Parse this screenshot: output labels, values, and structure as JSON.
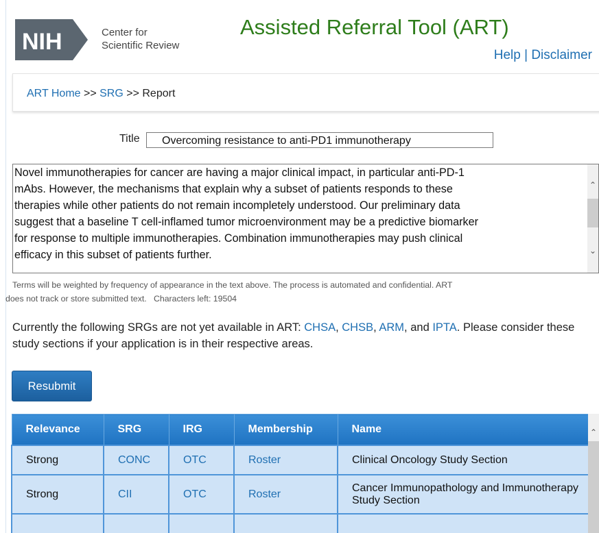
{
  "header": {
    "logo_text": "NIH",
    "org_line1": "Center for",
    "org_line2": "Scientific Review",
    "app_title": "Assisted Referral Tool (ART)",
    "help_link": "Help",
    "separator": "|",
    "disclaimer_link": "Disclaimer"
  },
  "breadcrumb": {
    "home": "ART Home",
    "sep1": " >> ",
    "srg": "SRG",
    "sep2": " >> ",
    "current": "Report"
  },
  "form": {
    "title_label": "Title",
    "title_value": "Overcoming resistance to anti-PD1 immunotherapy",
    "abstract_lines": [
      "Novel immunotherapies for cancer are having a major clinical impact, in particular anti-PD-1",
      "mAbs. However, the mechanisms that explain why a subset of patients responds to these",
      "therapies while other patients do not remain incompletely understood. Our preliminary data",
      "suggest that a baseline T cell-inflamed tumor microenvironment may be a predictive biomarker",
      "for response to multiple immunotherapies. Combination immunotherapies may push clinical",
      "efficacy in this subset of patients further."
    ],
    "hint_line1": "Terms will be weighted by frequency of appearance in the text above. The process is automated and confidential. ART",
    "hint_line2": "does not track or store submitted text.",
    "chars_left_label": "Characters left:",
    "chars_left_value": "19504",
    "resubmit_label": "Resubmit"
  },
  "notice": {
    "prefix": "Currently the following SRGs are not yet available in ART: ",
    "links": [
      "CHSA",
      "CHSB",
      "ARM",
      "IPTA"
    ],
    "comma": ", ",
    "and": ", and ",
    "suffix": ". Please consider these study sections if your application is in their respective areas."
  },
  "table": {
    "columns": [
      "Relevance",
      "SRG",
      "IRG",
      "Membership",
      "Name"
    ],
    "rows": [
      {
        "relevance": "Strong",
        "srg": "CONC",
        "irg": "OTC",
        "membership": "Roster",
        "name": "Clinical Oncology Study Section"
      },
      {
        "relevance": "Strong",
        "srg": "CII",
        "irg": "OTC",
        "membership": "Roster",
        "name": "Cancer Immunopathology and Immunotherapy Study Section"
      },
      {
        "relevance": "",
        "srg": "",
        "irg": "",
        "membership": "",
        "name": ""
      }
    ]
  },
  "colors": {
    "title_green": "#2e7d1b",
    "link_blue": "#1f6fb2",
    "table_header": "#1f73c2",
    "table_row": "#cfe3f7"
  }
}
